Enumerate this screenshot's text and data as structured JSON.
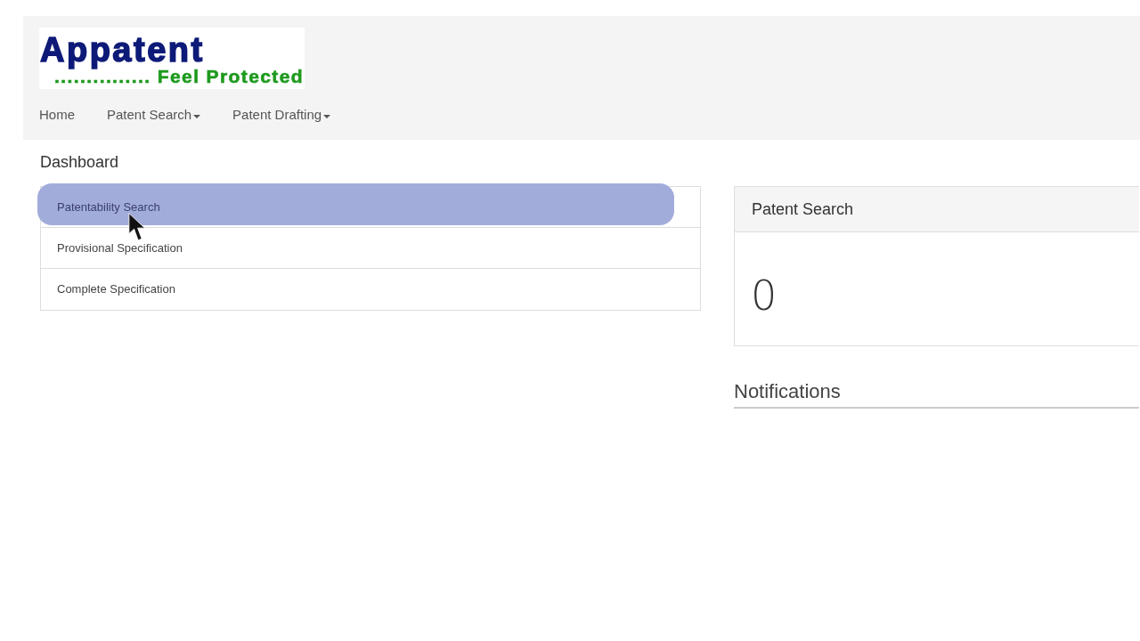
{
  "logo": {
    "name": "Appatent",
    "tagline": "............... Feel Protected"
  },
  "nav": [
    {
      "label": "Home",
      "dropdown": false
    },
    {
      "label": "Patent Search",
      "dropdown": true
    },
    {
      "label": "Patent Drafting",
      "dropdown": true
    }
  ],
  "page_title": "Dashboard",
  "list": [
    {
      "label": "Patentability Search",
      "highlighted": true
    },
    {
      "label": "Provisional Specification",
      "highlighted": false
    },
    {
      "label": "Complete Specification",
      "highlighted": false
    }
  ],
  "panel": {
    "title": "Patent Search",
    "count": "0"
  },
  "notifications": {
    "title": "Notifications"
  }
}
